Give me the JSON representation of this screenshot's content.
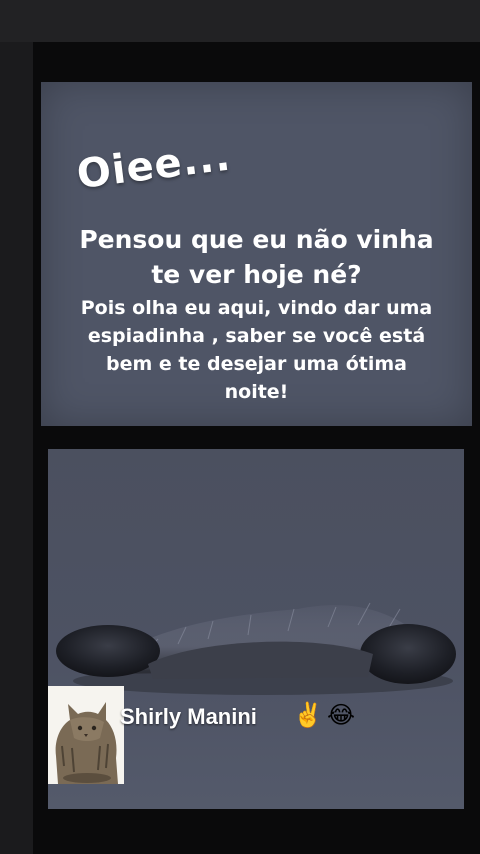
{
  "greeting": "Oiee...",
  "headline_lines": [
    "Pensou que eu não vinha",
    "te ver hoje né?"
  ],
  "body_lines": [
    "Pois olha eu aqui, vindo dar uma",
    "espiadinha , saber se você está",
    "bem e te desejar uma ótima",
    "noite!"
  ],
  "signature": {
    "name": "Shirly Manini",
    "emojis": [
      "✌️",
      "😂"
    ]
  },
  "icons": {
    "avatar": "cat-sticker-icon",
    "paws": "cat-paws-peeking-icon"
  },
  "colors": {
    "background": "#0a0a0b",
    "card": "#4f5566",
    "text": "#ffffff"
  }
}
